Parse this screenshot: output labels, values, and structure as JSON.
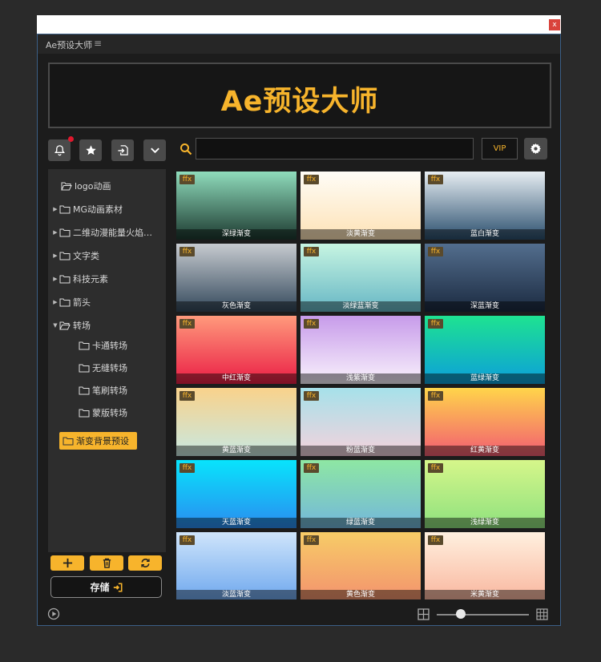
{
  "window": {
    "title": "Ae预设大师",
    "close_label": "x"
  },
  "banner": {
    "title": "Ae预设大师"
  },
  "toolbar": {
    "search_value": "",
    "vip_label": "VIP"
  },
  "sidebar": {
    "items": [
      {
        "label": "logo动画",
        "expandable": false,
        "open": true
      },
      {
        "label": "MG动画素材",
        "expandable": true,
        "open": false
      },
      {
        "label": "二维动漫能量火焰…",
        "expandable": true,
        "open": false
      },
      {
        "label": "文字类",
        "expandable": true,
        "open": false
      },
      {
        "label": "科技元素",
        "expandable": true,
        "open": false
      },
      {
        "label": "箭头",
        "expandable": true,
        "open": false
      },
      {
        "label": "转场",
        "expandable": true,
        "open": true
      },
      {
        "label": "卡通转场",
        "child": true
      },
      {
        "label": "无缝转场",
        "child": true
      },
      {
        "label": "笔刷转场",
        "child": true
      },
      {
        "label": "蒙版转场",
        "child": true
      },
      {
        "label": "渐变背景预设",
        "selected": true
      }
    ],
    "save_label": "存储"
  },
  "presets": [
    {
      "tag": "ffx",
      "label": "深绿渐变",
      "colors": [
        "#8fdcbc",
        "#1d3a30"
      ]
    },
    {
      "tag": "ffx",
      "label": "淡黄渐变",
      "colors": [
        "#fffdf7",
        "#fde2b6"
      ]
    },
    {
      "tag": "ffx",
      "label": "蓝白渐变",
      "colors": [
        "#e7eef3",
        "#2b4f6e"
      ]
    },
    {
      "tag": "ffx",
      "label": "灰色渐变",
      "colors": [
        "#c7cbd0",
        "#34495c"
      ]
    },
    {
      "tag": "ffx",
      "label": "淡绿蓝渐变",
      "colors": [
        "#c7f5e2",
        "#66b6c4"
      ]
    },
    {
      "tag": "ffx",
      "label": "深蓝渐变",
      "colors": [
        "#536e8e",
        "#1b2a40"
      ]
    },
    {
      "tag": "ffx",
      "label": "中红渐变",
      "colors": [
        "#ff9a7c",
        "#ea1e45"
      ]
    },
    {
      "tag": "ffx",
      "label": "浅紫渐变",
      "colors": [
        "#c79bea",
        "#f9f2fc"
      ]
    },
    {
      "tag": "ffx",
      "label": "蓝绿渐变",
      "colors": [
        "#1ee391",
        "#0c9fda"
      ]
    },
    {
      "tag": "ffx",
      "label": "黄蓝渐变",
      "colors": [
        "#f9d28b",
        "#c8e8e1"
      ]
    },
    {
      "tag": "ffx",
      "label": "粉蓝渐变",
      "colors": [
        "#a6e1ea",
        "#f4d2dc"
      ]
    },
    {
      "tag": "ffx",
      "label": "红黄渐变",
      "colors": [
        "#ffd54a",
        "#f25d72"
      ]
    },
    {
      "tag": "ffx",
      "label": "天蓝渐变",
      "colors": [
        "#08e4fc",
        "#2a8cf0"
      ]
    },
    {
      "tag": "ffx",
      "label": "绿蓝渐变",
      "colors": [
        "#8ee7a3",
        "#73b7db"
      ]
    },
    {
      "tag": "ffx",
      "label": "浅绿渐变",
      "colors": [
        "#d6f68a",
        "#8ee17e"
      ]
    },
    {
      "tag": "ffx",
      "label": "淡蓝渐变",
      "colors": [
        "#cfe5fb",
        "#6fa8ee"
      ]
    },
    {
      "tag": "ffx",
      "label": "黄色渐变",
      "colors": [
        "#f7cc67",
        "#f3936e"
      ]
    },
    {
      "tag": "ffx",
      "label": "米黄渐变",
      "colors": [
        "#fff0df",
        "#f9b79f"
      ]
    }
  ],
  "colors": {
    "accent": "#f7b42c",
    "background": "#1c1c1c",
    "panel": "#2d2d2d",
    "notification": "#e0182d"
  }
}
